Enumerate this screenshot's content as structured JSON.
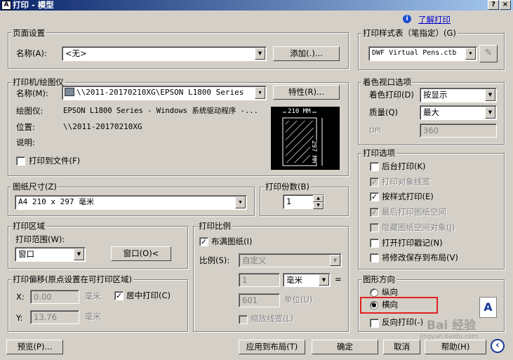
{
  "window": {
    "title": "打印 - 模型",
    "help_btn": "?",
    "close_btn": "×",
    "app_icon": "A"
  },
  "help_link": "了解打印",
  "page_setup": {
    "group": "页面设置",
    "name_label": "名称(A):",
    "name_value": "<无>",
    "add_button": "添加(.)..."
  },
  "printer": {
    "group": "打印机/绘图仪",
    "name_label": "名称(M):",
    "name_value": "\\\\2011-20170210XG\\EPSON L1800 Series",
    "properties_button": "特性(R)...",
    "plotter_label": "绘图仪:",
    "plotter_value": "EPSON L1800 Series - Windows 系统驱动程序 -...",
    "location_label": "位置:",
    "location_value": "\\\\2011-20170210XG",
    "description_label": "说明:",
    "print_to_file": "打印到文件(F)",
    "preview_width": "210 MM",
    "preview_height": "297 MM"
  },
  "paper_size": {
    "group": "图纸尺寸(Z)",
    "value": "A4 210 x 297 毫米"
  },
  "copies": {
    "group": "打印份数(B)",
    "value": "1"
  },
  "plot_area": {
    "group": "打印区域",
    "range_label": "打印范围(W):",
    "range_value": "窗口",
    "window_button": "窗口(O)<"
  },
  "plot_offset": {
    "group": "打印偏移(原点设置在可打印区域)",
    "x_label": "X:",
    "x_value": "0.00",
    "x_unit": "毫米",
    "y_label": "Y:",
    "y_value": "13.76",
    "y_unit": "毫米",
    "center_label": "居中打印(C)"
  },
  "plot_scale": {
    "group": "打印比例",
    "fit_label": "布满图纸(I)",
    "scale_label": "比例(S):",
    "scale_value": "自定义",
    "value1": "1",
    "unit_value": "毫米",
    "equals": "=",
    "value2": "601",
    "unit_label": "单位(U)",
    "lineweights_label": "缩放线宽(L)"
  },
  "style_table": {
    "group": "打印样式表（笔指定）(G)",
    "value": "DWF Virtual Pens.ctb"
  },
  "shaded": {
    "group": "着色视口选项",
    "shade_label": "着色打印(D)",
    "shade_value": "按显示",
    "quality_label": "质量(Q)",
    "quality_value": "最大",
    "dpi_label": "DPI",
    "dpi_value": "360"
  },
  "plot_options": {
    "group": "打印选项",
    "items": [
      {
        "label": "后台打印(K)",
        "checked": false,
        "enabled": true
      },
      {
        "label": "打印对象线宽",
        "checked": true,
        "enabled": false
      },
      {
        "label": "按样式打印(E)",
        "checked": true,
        "enabled": true
      },
      {
        "label": "最后打印图纸空间",
        "checked": true,
        "enabled": false
      },
      {
        "label": "隐藏图纸空间对象(J)",
        "checked": false,
        "enabled": false
      },
      {
        "label": "打开打印戳记(N)",
        "checked": false,
        "enabled": true
      },
      {
        "label": "将修改保存到布局(V)",
        "checked": false,
        "enabled": true
      }
    ]
  },
  "orientation": {
    "group": "图形方向",
    "portrait": "纵向",
    "landscape": "横向",
    "reverse": "反向打印(-)",
    "selected": "landscape",
    "icon_letter": "A"
  },
  "footer": {
    "preview": "预览(P)...",
    "apply_layout": "应用到布局(T)",
    "ok": "确定",
    "cancel": "取消",
    "help": "帮助(H)",
    "expand": "‹"
  },
  "watermark": {
    "text": "Bai 经验",
    "sub": "jingyan.baidu.com"
  },
  "check_mark": "✓",
  "radio_dot": "●",
  "arrow_down": "▼",
  "arrow_up": "▲"
}
